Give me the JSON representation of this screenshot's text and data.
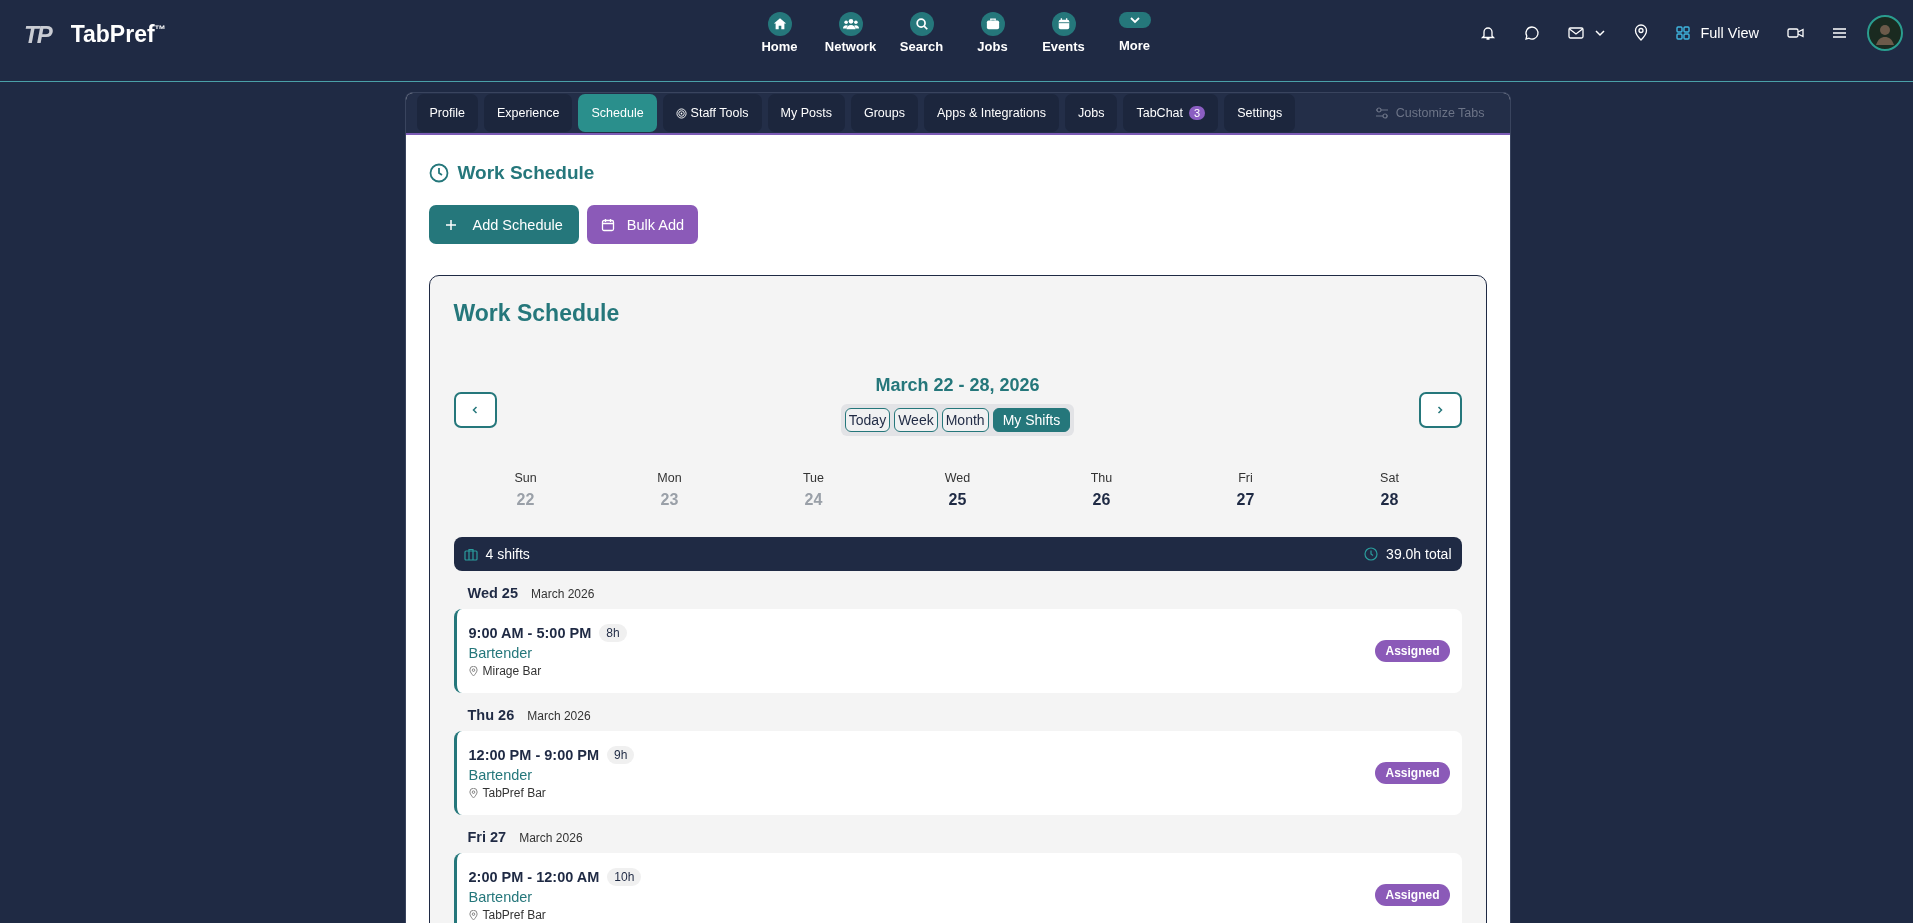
{
  "brand": {
    "logo": "TP",
    "name": "TabPref",
    "mark": "™"
  },
  "nav": [
    {
      "label": "Home",
      "kind": "home"
    },
    {
      "label": "Network",
      "kind": "network"
    },
    {
      "label": "Search",
      "kind": "search"
    },
    {
      "label": "Jobs",
      "kind": "jobs"
    },
    {
      "label": "Events",
      "kind": "events"
    },
    {
      "label": "More",
      "kind": "more"
    }
  ],
  "full_view": {
    "label": "Full View"
  },
  "tabs": [
    {
      "label": "Profile",
      "selected": false
    },
    {
      "label": "Experience",
      "selected": false
    },
    {
      "label": "Schedule",
      "selected": true
    },
    {
      "label": "Staff Tools",
      "selected": false,
      "kind": "tools"
    },
    {
      "label": "My Posts",
      "selected": false
    },
    {
      "label": "Groups",
      "selected": false
    },
    {
      "label": "Apps & Integrations",
      "selected": false
    },
    {
      "label": "Jobs",
      "selected": false
    },
    {
      "label": "TabChat",
      "selected": false,
      "badge": "3"
    },
    {
      "label": "Settings",
      "selected": false
    }
  ],
  "customize": {
    "label": "Customize Tabs",
    "disabled": true
  },
  "page_title": "Work Schedule",
  "actions": [
    {
      "label": "Add Schedule",
      "kind": "add"
    },
    {
      "label": "Bulk Add",
      "kind": "bulk"
    }
  ],
  "schedule": {
    "title": "Work Schedule",
    "range": "March 22 - 28, 2026",
    "views": [
      {
        "label": "Today",
        "selected": false
      },
      {
        "label": "Week",
        "selected": false
      },
      {
        "label": "Month",
        "selected": false
      },
      {
        "label": "My Shifts",
        "selected": true
      }
    ],
    "days": [
      {
        "name": "Sun",
        "date": "22",
        "past": true
      },
      {
        "name": "Mon",
        "date": "23",
        "past": true
      },
      {
        "name": "Tue",
        "date": "24",
        "past": true
      },
      {
        "name": "Wed",
        "date": "25",
        "past": false
      },
      {
        "name": "Thu",
        "date": "26",
        "past": false
      },
      {
        "name": "Fri",
        "date": "27",
        "past": false
      },
      {
        "name": "Sat",
        "date": "28",
        "past": false
      }
    ],
    "summary": {
      "count": "4 shifts",
      "total": "39.0h total"
    },
    "groups": [
      {
        "day": "Wed 25",
        "month": "March 2026",
        "shifts": [
          {
            "time": "9:00 AM - 5:00 PM",
            "hours": "8h",
            "role": "Bartender",
            "place": "Mirage Bar",
            "status": "Assigned"
          }
        ]
      },
      {
        "day": "Thu 26",
        "month": "March 2026",
        "shifts": [
          {
            "time": "12:00 PM - 9:00 PM",
            "hours": "9h",
            "role": "Bartender",
            "place": "TabPref Bar",
            "status": "Assigned"
          }
        ]
      },
      {
        "day": "Fri 27",
        "month": "March 2026",
        "shifts": [
          {
            "time": "2:00 PM - 12:00 AM",
            "hours": "10h",
            "role": "Bartender",
            "place": "TabPref Bar",
            "status": "Assigned"
          }
        ]
      }
    ]
  }
}
